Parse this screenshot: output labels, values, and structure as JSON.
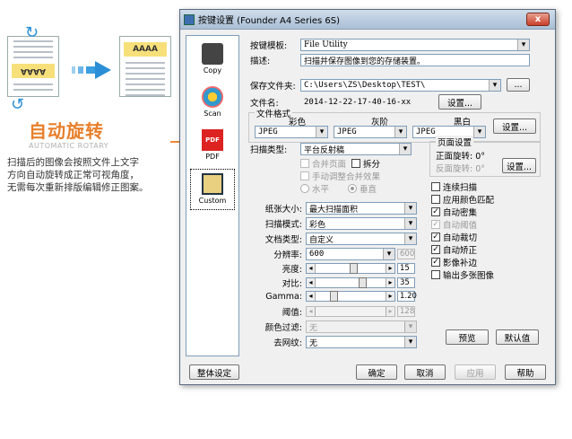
{
  "promo": {
    "doc_text": "AAAA",
    "title": "自动旋转",
    "subtitle": "AUTOMATIC ROTARY",
    "desc1": "扫描后的图像会按照文件上文字",
    "desc2": "方向自动旋转成正常可视角度，",
    "desc3": "无需每次重新排版编辑修正图案。",
    "accent_color": "#e87f2b"
  },
  "dialog": {
    "title": "按键设置 (Founder A4 Series 6S)",
    "close": "x"
  },
  "sidebar": {
    "items": [
      {
        "label": "Copy",
        "icon": "printer-icon"
      },
      {
        "label": "Scan",
        "icon": "scan-icon"
      },
      {
        "label": "PDF",
        "icon": "pdf-icon"
      },
      {
        "label": "Custom",
        "icon": "custom-icon"
      }
    ]
  },
  "form": {
    "template_label": "按键模板:",
    "template_value": "File Utility",
    "desc_label": "描述:",
    "desc_value": "扫描并保存图像到您的存储装置。",
    "save_folder_label": "保存文件夹:",
    "save_folder_value": "C:\\Users\\ZS\\Desktop\\TEST\\",
    "browse": "...",
    "filename_label": "文件名:",
    "filename_value": "2014-12-22-17-40-16-xx",
    "settings": "设置...",
    "format_group": "文件格式",
    "color_label": "彩色",
    "gray_label": "灰阶",
    "bw_label": "黑白",
    "color_value": "JPEG",
    "gray_value": "JPEG",
    "bw_value": "JPEG",
    "scan_type_label": "扫描类型:",
    "scan_type_value": "平台反射稿",
    "merge_pages": "合并页面",
    "split": "拆分",
    "manual_merge": "手动调整合并效果",
    "horizontal": "水平",
    "vertical": "垂直",
    "page_group": "页面设置",
    "front_rotate": "正面旋转: 0°",
    "back_rotate": "反面旋转: 0°",
    "continuous_scan": "连续扫描",
    "apply_color_match": "应用颜色匹配",
    "auto_density": "自动密集",
    "auto_threshold": "自动阈值",
    "auto_crop": "自动裁切",
    "auto_deskew": "自动矫正",
    "image_fill": "影像补边",
    "output_multi": "输出多张图像",
    "paper_size_label": "纸张大小:",
    "paper_size_value": "最大扫描面积",
    "scan_mode_label": "扫描模式:",
    "scan_mode_value": "彩色",
    "doc_type_label": "文档类型:",
    "doc_type_value": "自定义",
    "resolution_label": "分辨率:",
    "resolution_value": "600",
    "resolution_side": "600",
    "brightness_label": "亮度:",
    "brightness_value": "15",
    "contrast_label": "对比:",
    "contrast_value": "35",
    "gamma_label": "Gamma:",
    "gamma_value": "1.20",
    "threshold_label": "阈值:",
    "threshold_value": "128",
    "color_filter_label": "颜色过滤:",
    "color_filter_value": "无",
    "moire_label": "去网纹:",
    "moire_value": "无",
    "preview": "预览",
    "defaults": "默认值"
  },
  "footer": {
    "reorder": "整体设定",
    "ok": "确定",
    "cancel": "取消",
    "apply": "应用",
    "help": "帮助"
  }
}
